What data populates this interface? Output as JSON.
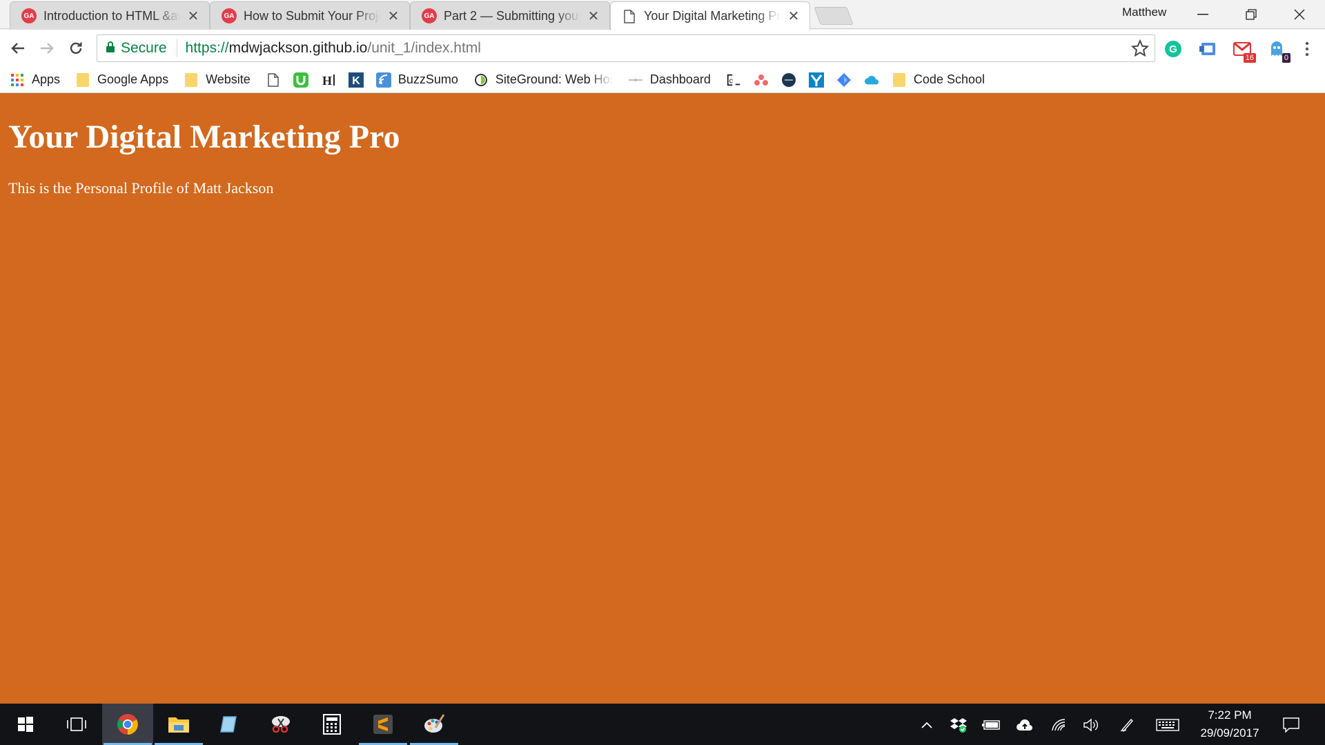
{
  "browser": {
    "tabs": [
      {
        "title": "Introduction to HTML &amp;",
        "favicon": "GA"
      },
      {
        "title": "How to Submit Your Project",
        "favicon": "GA"
      },
      {
        "title": "Part 2 — Submitting your",
        "favicon": "GA"
      },
      {
        "title": "Your Digital Marketing Pro",
        "favicon": "doc-icon"
      }
    ],
    "profile_name": "Matthew",
    "address": {
      "secure_label": "Secure",
      "url_scheme": "https://",
      "url_host": "mdwjackson.github.io",
      "url_path": "/unit_1/index.html"
    },
    "extensions": {
      "mail_badge": "16",
      "ghost_badge": "0"
    },
    "bookmarks": {
      "apps": "Apps",
      "google_apps": "Google Apps",
      "website": "Website",
      "buzzsumo": "BuzzSumo",
      "siteground": "SiteGround: Web Hos",
      "dashboard": "Dashboard",
      "code_school": "Code School"
    },
    "colors": {
      "secure_green": "#0b8043",
      "tab_favicon": "#e23d4a"
    }
  },
  "page": {
    "heading": "Your Digital Marketing Pro",
    "paragraph": "This is the Personal Profile of Matt Jackson",
    "background": "#d2691e"
  },
  "taskbar": {
    "time": "7:22 PM",
    "date": "29/09/2017"
  }
}
